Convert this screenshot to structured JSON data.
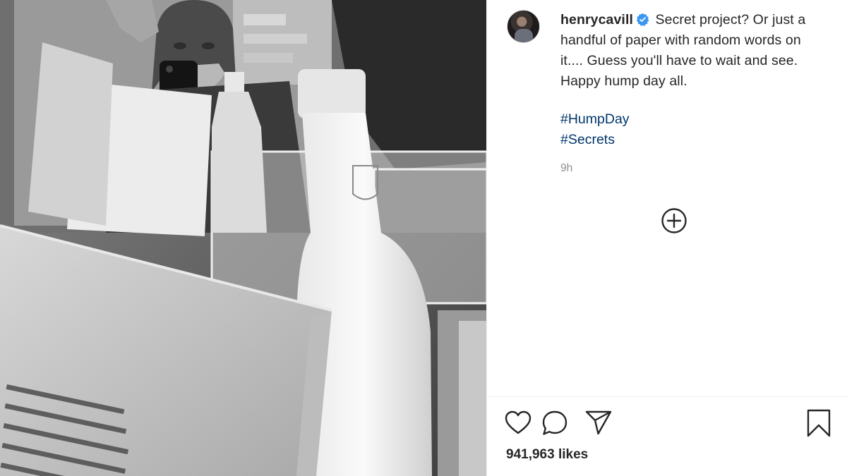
{
  "post": {
    "image_icon": "photo-mirror-selfie",
    "author": {
      "username": "henrycavill",
      "avatar_icon": "profile-avatar-icon",
      "verified_icon": "verified-badge-icon",
      "verified_color": "#3897f0"
    },
    "caption": "Secret project? Or just a handful of paper with random words on it.... Guess you'll have to wait and see. Happy hump day all.",
    "hashtags": [
      "#HumpDay",
      "#Secrets"
    ],
    "timestamp": "9h",
    "load_more_icon": "plus-circle-icon",
    "actions": {
      "like_icon": "heart-icon",
      "comment_icon": "comment-bubble-icon",
      "share_icon": "paper-plane-icon",
      "save_icon": "bookmark-icon"
    },
    "likes": "941,963 likes",
    "colors": {
      "text": "#262626",
      "hashtag": "#00376b",
      "muted": "#8e8e8e"
    }
  }
}
